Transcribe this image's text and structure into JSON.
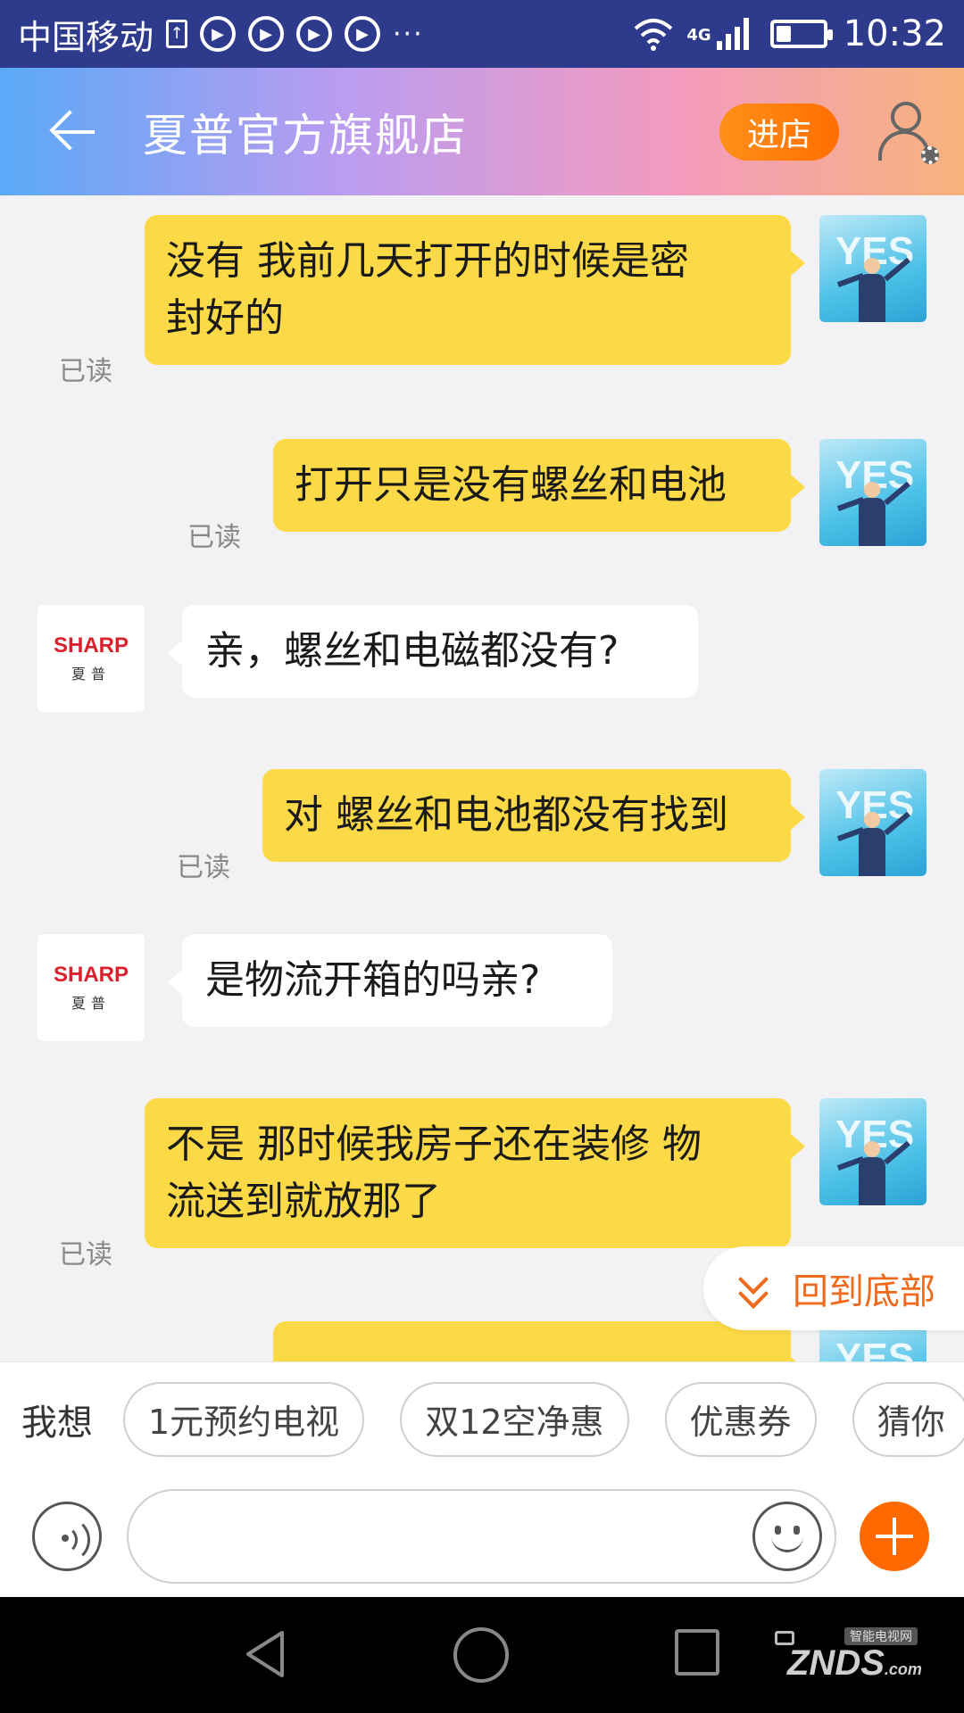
{
  "status_bar": {
    "carrier": "中国移动",
    "network": "4G",
    "time": "10:32",
    "battery_level": 0.3
  },
  "header": {
    "title": "夏普官方旗舰店",
    "enter_button": "进店"
  },
  "messages": [
    {
      "side": "right",
      "text_lines": [
        "没有  我前几天打开的时候是密",
        "封好的"
      ],
      "read": "已读"
    },
    {
      "side": "right",
      "text_lines": [
        "打开只是没有螺丝和电池"
      ],
      "read": "已读"
    },
    {
      "side": "left",
      "text_lines": [
        "亲，螺丝和电磁都没有?"
      ]
    },
    {
      "side": "right",
      "text_lines": [
        "对 螺丝和电池都没有找到"
      ],
      "read": "已读"
    },
    {
      "side": "left",
      "text_lines": [
        "是物流开箱的吗亲?"
      ]
    },
    {
      "side": "right",
      "text_lines": [
        "不是  那时候我房子还在装修  物",
        "流送到就放那了"
      ],
      "read": "已读"
    }
  ],
  "shop_avatar": {
    "brand": "SHARP",
    "brand_cn": "夏普"
  },
  "user_avatar": {
    "text": "YES"
  },
  "back_to_bottom": "回到底部",
  "suggestions": {
    "label": "我想",
    "chips": [
      "1元预约电视",
      "双12空净惠",
      "优惠券",
      "猜你"
    ]
  },
  "input": {
    "placeholder": ""
  },
  "watermark": {
    "top": "智能电视网",
    "main": "ZNDS",
    "suffix": ".com"
  },
  "colors": {
    "my_bubble": "#fcd947",
    "accent": "#ff6a00",
    "status_bar": "#2e3a8c"
  }
}
